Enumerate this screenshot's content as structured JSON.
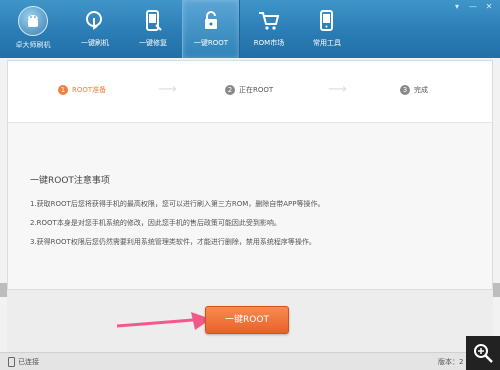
{
  "window": {
    "logo_label": "卓大师刷机",
    "window_buttons": [
      "▾",
      "—",
      "✕"
    ]
  },
  "nav": [
    {
      "label": "一键刷机",
      "icon": "refresh-touch-icon"
    },
    {
      "label": "一键修复",
      "icon": "phone-repair-icon"
    },
    {
      "label": "一键ROOT",
      "icon": "lock-unlock-icon"
    },
    {
      "label": "ROM市场",
      "icon": "cart-icon"
    },
    {
      "label": "常用工具",
      "icon": "phone-tools-icon"
    }
  ],
  "steps": [
    {
      "num": "1",
      "label": "ROOT准备"
    },
    {
      "num": "2",
      "label": "正在ROOT"
    },
    {
      "num": "3",
      "label": "完成"
    }
  ],
  "notice": {
    "title": "一键ROOT注意事项",
    "lines": [
      "1.获取ROOT后您将获得手机的最高权限，您可以进行刷入第三方ROM，删除自带APP等操作。",
      "2.ROOT本身是对您手机系统的修改，因此您手机的售后政策可能因此受到影响。",
      "3.获得ROOT权限后您仍然需要利用系统管理类软件，才能进行删除，禁用系统程序等操作。"
    ]
  },
  "actions": {
    "root_button": "一键ROOT"
  },
  "status": {
    "connection": "已连接",
    "version": "版本：2"
  },
  "colors": {
    "accent": "#f07f3c",
    "header": "#2b7db5",
    "button": "#e8612a"
  }
}
